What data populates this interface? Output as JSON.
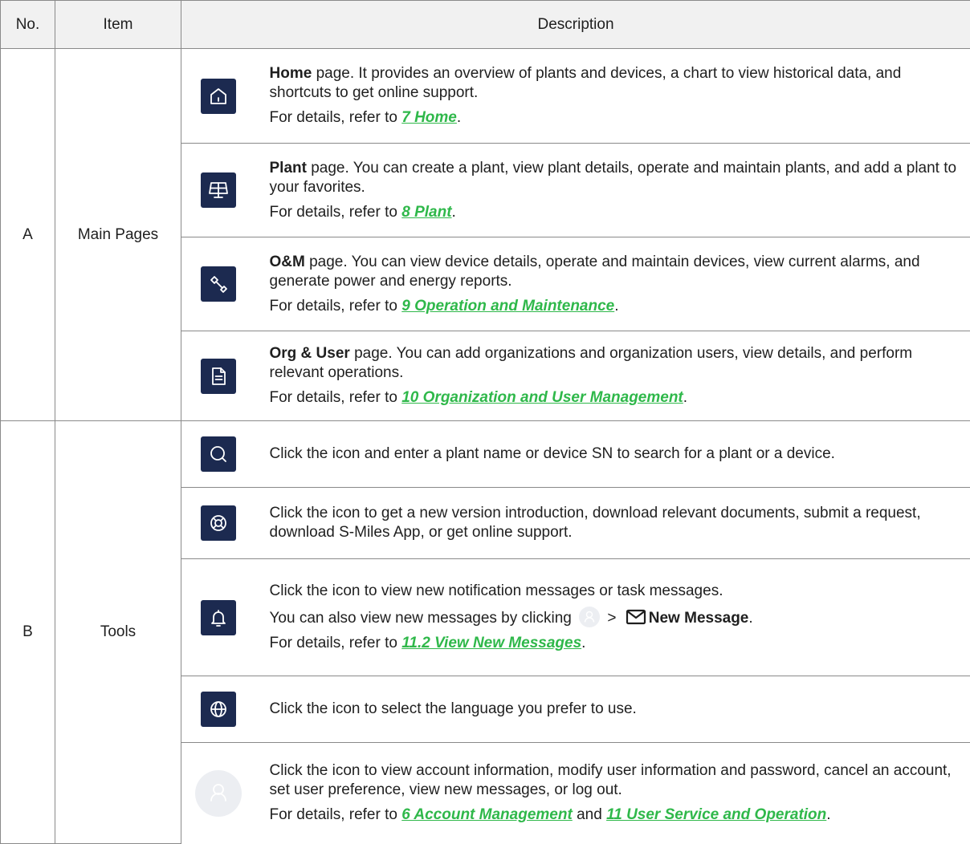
{
  "header": {
    "no": "No.",
    "item": "Item",
    "description": "Description"
  },
  "groupA": {
    "no": "A",
    "item": "Main Pages",
    "rows": [
      {
        "icon": "home-icon",
        "title": "Home",
        "text": " page. It provides an overview of plants and devices, a chart to view historical data, and shortcuts to get online support.",
        "ref_prefix": "For details, refer to ",
        "ref": "7 Home",
        "ref_suffix": "."
      },
      {
        "icon": "solar-panel-icon",
        "title": "Plant",
        "text": " page. You can create a plant, view plant details, operate and maintain plants, and add a plant to your favorites.",
        "ref_prefix": "For details, refer to ",
        "ref": "8 Plant",
        "ref_suffix": "."
      },
      {
        "icon": "wrench-icon",
        "title": "O&M",
        "text": " page. You can view device details, operate and maintain devices, view current alarms, and generate power and energy reports.",
        "ref_prefix": "For details, refer to ",
        "ref": "9 Operation and Maintenance",
        "ref_suffix": "."
      },
      {
        "icon": "document-icon",
        "title": "Org & User",
        "text": " page. You can add organizations and organization users, view details, and perform relevant operations.",
        "ref_prefix": "For details, refer to ",
        "ref": "10 Organization and User Management",
        "ref_suffix": "."
      }
    ]
  },
  "groupB": {
    "no": "B",
    "item": "Tools",
    "rows": [
      {
        "icon": "search-icon",
        "text": "Click the icon and enter a plant name or device SN to search for a plant or a device."
      },
      {
        "icon": "lifebuoy-icon",
        "text": "Click the icon to get a new version introduction, download relevant documents, submit a request, download S-Miles App, or get online support."
      },
      {
        "icon": "bell-icon",
        "text": "Click the icon to view new notification messages or task messages.",
        "line2_prefix": "You can also view new messages by clicking ",
        "line2_sep": " > ",
        "line2_bold": "New Message",
        "line2_suffix": ".",
        "ref_prefix": "For details, refer to ",
        "ref": "11.2 View New Messages",
        "ref_suffix": "."
      },
      {
        "icon": "globe-icon",
        "text": "Click the icon to select the language you prefer to use."
      },
      {
        "icon": "avatar-icon",
        "text": "Click the icon to view account information, modify user information and password, cancel an account, set user preference, view new messages, or log out.",
        "ref_prefix": "For details, refer to ",
        "ref": "6 Account Management",
        "ref_mid": " and ",
        "ref2": "11 User Service and Operation",
        "ref_suffix": "."
      }
    ]
  }
}
